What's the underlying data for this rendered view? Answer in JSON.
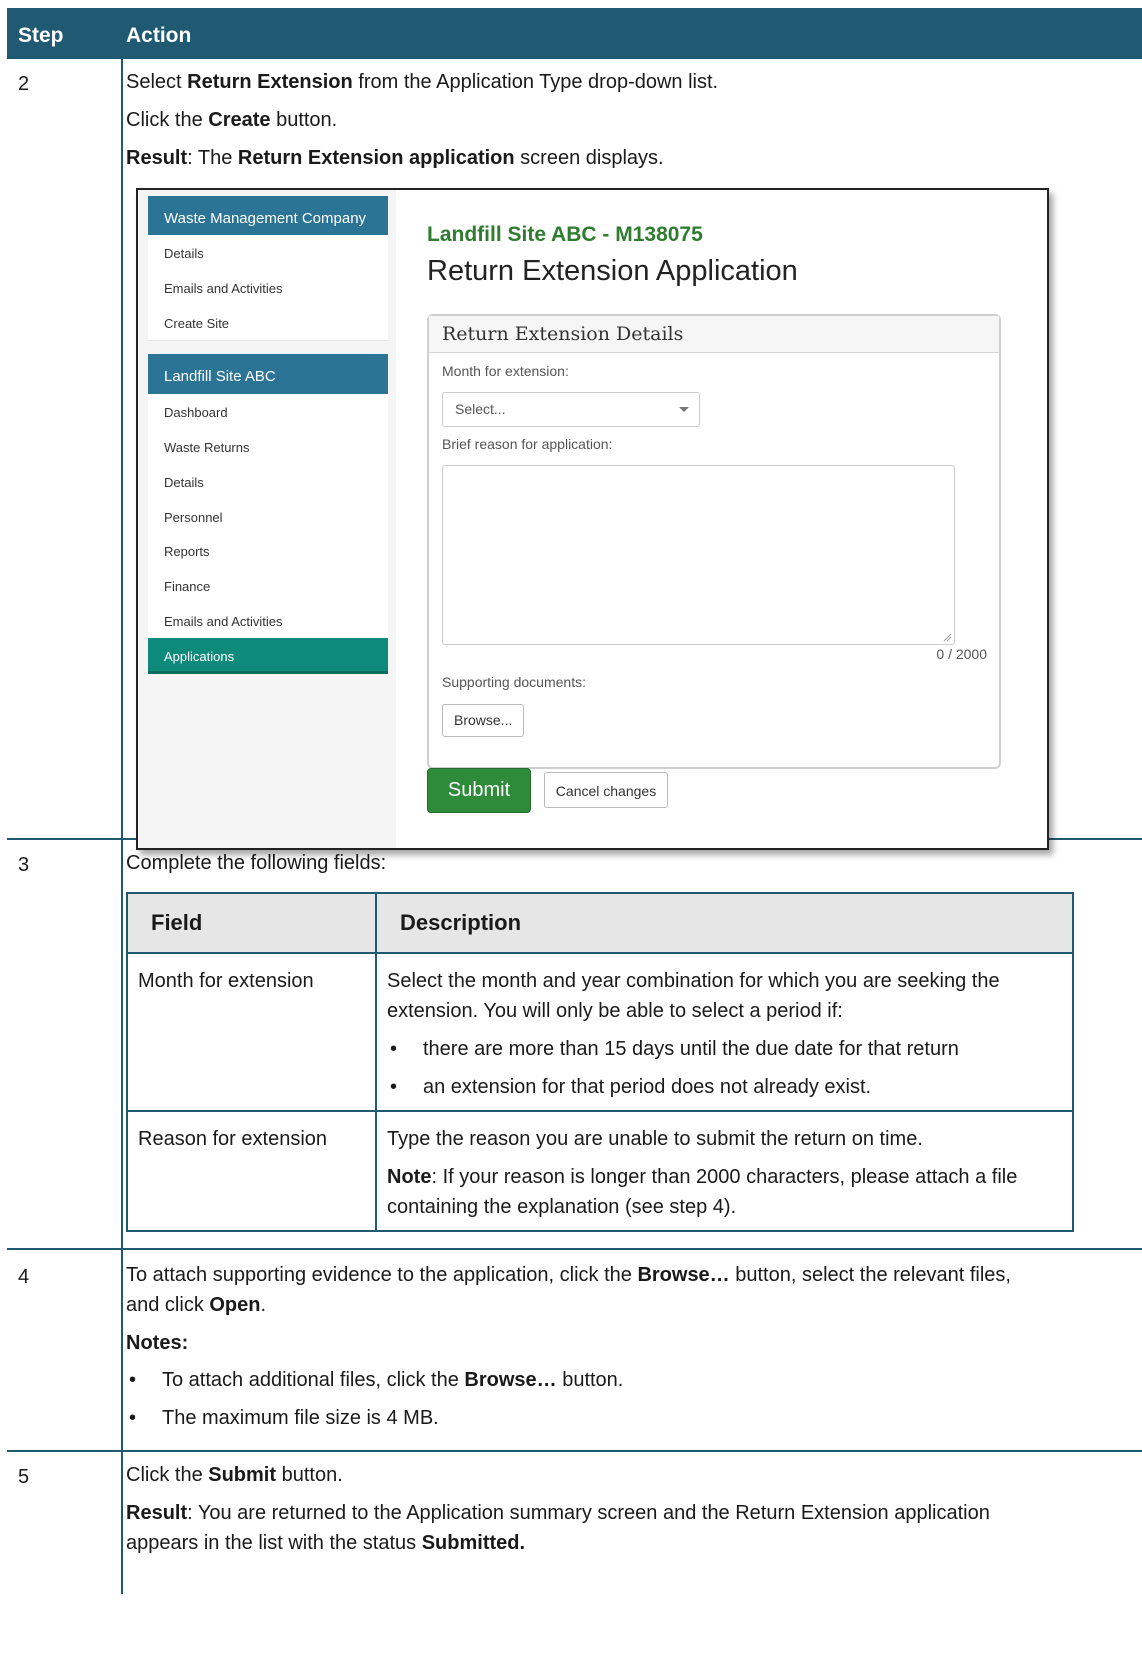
{
  "header": {
    "step": "Step",
    "action": "Action"
  },
  "steps": [
    {
      "num": "2",
      "lines": {
        "l1_a": "Select ",
        "l1_b": "Return Extension",
        "l1_c": " from the Application Type drop-down list.",
        "l2_a": "Click the ",
        "l2_b": "Create",
        "l2_c": " button.",
        "l3_a": "Result",
        "l3_b": ": The ",
        "l3_c": "Return Extension application",
        "l3_d": " screen displays."
      }
    },
    {
      "num": "3",
      "intro": "Complete the following fields:"
    },
    {
      "num": "4",
      "l1_a": "To attach supporting evidence to the application, click the ",
      "l1_b": "Browse…",
      "l1_c": " button, select the relevant files,",
      "l2_a": "and click ",
      "l2_b": "Open",
      "l2_c": ".",
      "notes": "Notes:",
      "b1_a": "To attach additional files, click the ",
      "b1_b": "Browse…",
      "b1_c": " button.",
      "b2": "The maximum file size is 4 MB."
    },
    {
      "num": "5",
      "l1_a": "Click the ",
      "l1_b": "Submit",
      "l1_c": " button.",
      "l2_a": "Result",
      "l2_b": ": You are returned to the Application summary screen and the Return Extension application",
      "l3_a": "appears in the list with the status ",
      "l3_b": "Submitted."
    }
  ],
  "screenshot": {
    "company": "Waste Management Company",
    "company_items": [
      "Details",
      "Emails and Activities",
      "Create Site"
    ],
    "site": "Landfill Site ABC",
    "site_items": [
      "Dashboard",
      "Waste Returns",
      "Details",
      "Personnel",
      "Reports",
      "Finance",
      "Emails and Activities",
      "Applications"
    ],
    "site_title": "Landfill Site ABC - M138075",
    "app_title": "Return Extension Application",
    "panel_title": "Return Extension Details",
    "month_label": "Month for extension:",
    "month_value": "Select...",
    "reason_label": "Brief reason for application:",
    "counter": "0 / 2000",
    "docs_label": "Supporting documents:",
    "browse": "Browse...",
    "submit": "Submit",
    "cancel": "Cancel changes"
  },
  "field_table": {
    "headers": [
      "Field",
      "Description"
    ],
    "rows": [
      {
        "field": "Month for extension",
        "desc": "Select the month and year combination for which you are seeking the extension. You will only be able to select a period if:",
        "bullets": [
          "there are more than 15 days until the due date for that return",
          "an extension for that period does not already exist."
        ]
      },
      {
        "field": "Reason for extension",
        "desc": "Type the reason you are unable to submit the return on time.",
        "note_label": "Note",
        "note_text": ": If your reason is longer than 2000 characters, please attach a file containing the explanation (see step 4)."
      }
    ]
  }
}
